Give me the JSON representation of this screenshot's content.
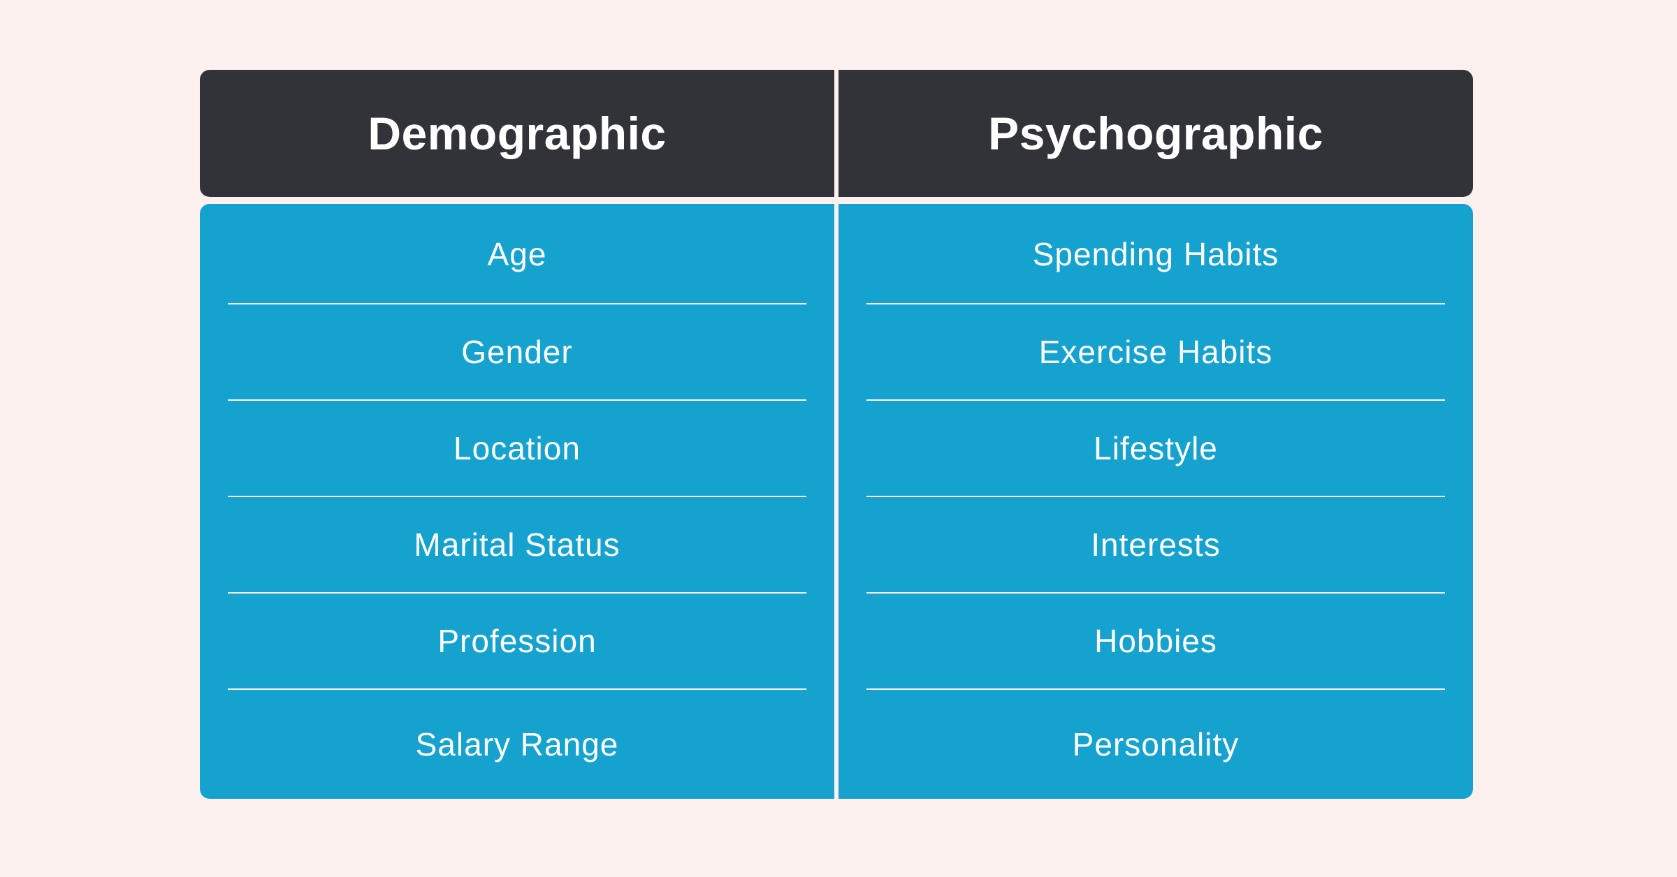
{
  "table": {
    "columns": [
      {
        "header": "Demographic",
        "items": [
          "Age",
          "Gender",
          "Location",
          "Marital Status",
          "Profession",
          "Salary Range"
        ]
      },
      {
        "header": "Psychographic",
        "items": [
          "Spending Habits",
          "Exercise Habits",
          "Lifestyle",
          "Interests",
          "Hobbies",
          "Personality"
        ]
      }
    ]
  },
  "colors": {
    "background": "#fcf1ee",
    "header": "#323338",
    "body": "#16a2cf",
    "text": "#ffffff"
  }
}
